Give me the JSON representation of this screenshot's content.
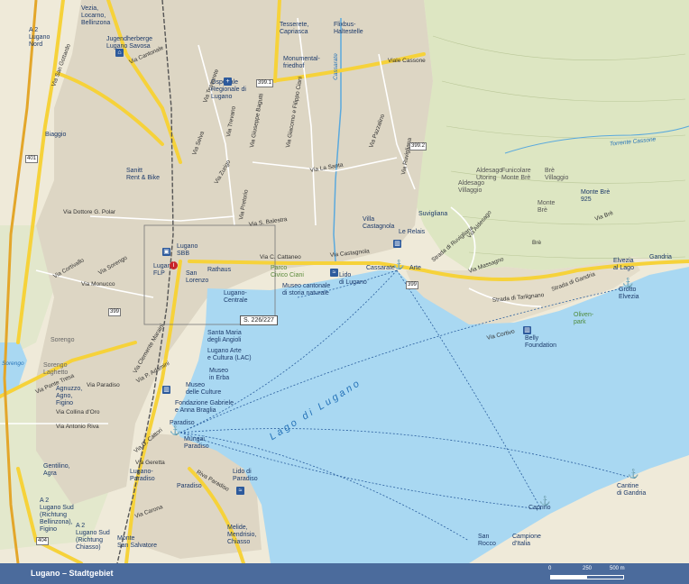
{
  "footer": {
    "title": "Lugano – Stadtgebiet",
    "scale_0": "0",
    "scale_250": "250",
    "scale_500": "500 m"
  },
  "colors": {
    "lake": "#a9d8f2",
    "land": "#f3efe2",
    "forest": "#dfe8c6",
    "urban": "#ddd8c8",
    "major_road": "#f6d23a",
    "footer": "#4b6b9c"
  },
  "places": {
    "vezia": "Vezia,\nLocarno,\nBellinzona",
    "lugano_nord": "A 2\nLugano\nNord",
    "jugendherberge": "Jugendherberge\nLugano Savosa",
    "ospedale": "Ospedale\nRegionale di\nLugano",
    "tesserete": "Tesserete,\nCapriasca",
    "flixbus": "Flixbus-\nHaltestelle",
    "monumentalfriedhof": "Monumental-\nfriedhof",
    "breganzona": "Breganzona",
    "sanitt": "Sanitt\nRent & Bike",
    "lugano_sbb": "Lugano\nSBB",
    "lugano_flp": "Lugano\nFLP",
    "san_lorenzo": "San\nLorenzo",
    "rathaus": "Rathaus",
    "lugano_centrale": "Lugano-\nCentrale",
    "parco": "Parco\nCivico Ciani",
    "museo_cantonale": "Museo cantonale\ndi storia naturale",
    "lido_lugano": "Lido\ndi Lugano",
    "cassarate": "Cassarate",
    "arte": "Arte",
    "le_relais": "Le Relais",
    "villa_castagnola": "Villa\nCastagnola",
    "suvigliana": "Suvigliana",
    "santa_maria": "Santa Maria\ndegli Angioli",
    "lac": "Lugano Arte\ne Cultura (LAC)",
    "museo_erba": "Museo\nin Erba",
    "museo_culture": "Museo\ndelle Culture",
    "fondazione": "Fondazione Gabriele\ne Anna Braglia",
    "paradiso": "Paradiso",
    "mungai": "Mungai\nParadiso",
    "lido_paradiso": "Lido di\nParadiso",
    "lugano_paradiso": "Lugano-\nParadiso",
    "paradiso2": "Paradiso",
    "sorengo": "Sorengo",
    "sorengo_laghetto": "Sorengo\nLaghetto",
    "agnuzzo": "Agnuzzo,\nAgno,\nFigino",
    "gentilino": "Gentilino,\nAgra",
    "lugano_sud_a": "A 2\nLugano Sud\n(Richtung\nBellinzona),\nFigino",
    "lugano_sud_b": "A 2\nLugano Sud\n(Richtung\nChiasso)",
    "monte_salvatore": "Monte\nSan Salvatore",
    "melide": "Melide,\nMendrisio,\nChiasso",
    "san_rocco": "San\nRocco",
    "campione": "Campione\nd'Italia",
    "caprino": "Caprino",
    "cantine": "Cantine\ndi Gandria",
    "gandria": "Gandria",
    "elvezia": "Elvezia\nal Lago",
    "grotto": "Grotto\nElvezia",
    "oliven": "Oliven-\npark",
    "belly": "Belly\nFoundation",
    "aldesago": "Aldesago\nVillaggio",
    "aldesago_uttoring": "Aldesago\nUtoring",
    "funicolare": "Funicolare\nMonte Brè",
    "bre_villaggio": "Brè\nVillaggio",
    "monte_bre": "Monte Brè\n925",
    "monte_bre_lbl": "Monte\nBrè",
    "biaggio": "Biaggio",
    "brè_street": "Brè",
    "torrente": "Torrente Cassone",
    "cassarate_river": "Cassarate",
    "lago": "Lago di Lugano",
    "sorengo_lake": "Sorengo"
  },
  "roads": {
    "san_gottardo": "Via San Gottardo",
    "via_cantonale": "Via Cantonale",
    "via_tesserete": "Via Tesserete",
    "via_monte_boglia": "Via Monte Boglia",
    "via_ospedale": "Via Ospedale",
    "via_beltramina": "Via Beltramina",
    "via_lugano": "Via Lugano",
    "via_selva": "Via Selva",
    "via_zurigo": "Via Zurigo",
    "via_trevano": "Via Trevano",
    "via_giuseppe_bagutti": "Via Giuseppe Bagutti",
    "via_pretorio": "Via Pretorio",
    "via_giacomo": "Via Giacomo e Filippo Ciani",
    "viale_cassone": "Viale Cassone",
    "via_pazzalino": "Via Pazzalino",
    "via_la_santa": "Via La Santa",
    "via_ruvigliana": "Via Ruvigliana",
    "via_dottore": "Via Dottore G. Polar",
    "via_balestra": "Via S. Balestra",
    "via_cattaneo": "Via C. Cattaneo",
    "via_castagnola": "Via Castagnola",
    "via_monucco": "Via Monucco",
    "via_cortivallo": "Via Cortivallo",
    "via_sorengo": "Via Sorengo",
    "via_clemente": "Via Clemente Maraini",
    "via_adamini": "Via P. Adamini",
    "via_ponte_tresa": "Via Ponte Tresa",
    "via_paradiso": "Via Paradiso",
    "via_collina": "Via Collina d'Oro",
    "via_riva": "Via Antonio Riva",
    "via_massagno": "Via Massagno",
    "via_cattori": "Via G. Cattori",
    "via_geretta": "Via Geretta",
    "via_carona": "Via Carona",
    "riva_paradiso": "Riva Paradiso",
    "via_cortivo": "Via Cortivo",
    "strada_gandria": "Strada di Gandria",
    "via_aldesago": "Via Aldesago",
    "strada_ruvigliana": "Strada di Ruvigliana",
    "via_suvigliana": "Via Suvigliana",
    "via_bre": "Via Brè",
    "via_serenita": "Strada di Tarlignano"
  },
  "route_numbers": {
    "r399a": "399.1",
    "r399b": "399.2",
    "r401": "401",
    "r399c": "399",
    "r404": "404",
    "r399d": "399"
  },
  "reference": "S. 226/227"
}
